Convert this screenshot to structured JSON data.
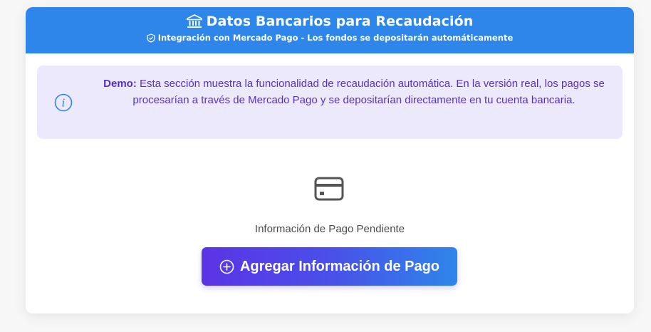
{
  "header": {
    "title": "Datos Bancarios para Recaudación",
    "subtitle": "Integración con Mercado Pago - Los fondos se depositarán automáticamente",
    "title_icon": "bank-icon",
    "subtitle_icon": "shield-icon",
    "background_color": "#2e86ea"
  },
  "notice": {
    "icon": "info-icon",
    "label": "Demo:",
    "text": " Esta sección muestra la funcionalidad de recaudación automática. En la versión real, los pagos se procesarían a través de Mercado Pago y se depositarían directamente en tu cuenta bancaria.",
    "background_color": "#ece9fd",
    "text_color": "#5a30c2"
  },
  "empty_state": {
    "icon": "credit-card-icon",
    "label": "Información de Pago Pendiente"
  },
  "action": {
    "label": "Agregar Información de Pago",
    "icon": "plus-circle-icon",
    "gradient": [
      "#5b34e6",
      "#2e86ea"
    ]
  }
}
